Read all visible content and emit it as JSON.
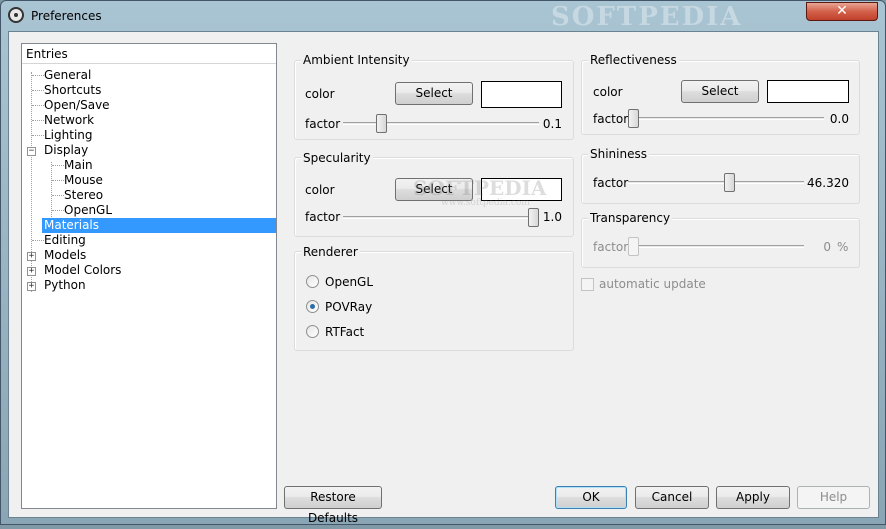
{
  "window": {
    "title": "Preferences",
    "watermark": "SOFTPEDIA",
    "close_glyph": "✕"
  },
  "tree": {
    "header": "Entries",
    "items": [
      {
        "label": "General"
      },
      {
        "label": "Shortcuts"
      },
      {
        "label": "Open/Save"
      },
      {
        "label": "Network"
      },
      {
        "label": "Lighting"
      },
      {
        "label": "Display",
        "expander": "−"
      },
      {
        "label": "Main"
      },
      {
        "label": "Mouse"
      },
      {
        "label": "Stereo"
      },
      {
        "label": "OpenGL"
      },
      {
        "label": "Materials",
        "selected": true
      },
      {
        "label": "Editing"
      },
      {
        "label": "Models",
        "expander": "+"
      },
      {
        "label": "Model Colors",
        "expander": "+"
      },
      {
        "label": "Python",
        "expander": "+"
      }
    ]
  },
  "ambient": {
    "title": "Ambient Intensity",
    "color_label": "color",
    "select_label": "Select",
    "factor_label": "factor",
    "factor_value": "0.1",
    "slider_fraction": 0.1
  },
  "specularity": {
    "title": "Specularity",
    "color_label": "color",
    "select_label": "Select",
    "factor_label": "factor",
    "factor_value": "1.0",
    "slider_fraction": 1.0,
    "watermark": "SOFTPEDIA",
    "watermark_url": "www.softpedia.com"
  },
  "renderer": {
    "title": "Renderer",
    "options": [
      {
        "label": "OpenGL",
        "checked": false
      },
      {
        "label": "POVRay",
        "checked": true
      },
      {
        "label": "RTFact",
        "checked": false
      }
    ]
  },
  "reflectiveness": {
    "title": "Reflectiveness",
    "color_label": "color",
    "select_label": "Select",
    "factor_label": "factor",
    "factor_value": "0.0",
    "slider_fraction": 0.0
  },
  "shininess": {
    "title": "Shininess",
    "factor_label": "factor",
    "factor_value": "46.320",
    "slider_fraction": 0.58
  },
  "transparency": {
    "title": "Transparency",
    "factor_label": "factor",
    "factor_value": "0",
    "unit": "%",
    "slider_fraction": 0.0
  },
  "auto_update": {
    "label": "automatic update",
    "checked": false
  },
  "buttons": {
    "restore": "Restore Defaults",
    "ok": "OK",
    "cancel": "Cancel",
    "apply": "Apply",
    "help": "Help"
  },
  "colors": {
    "selection": "#3399ff",
    "close_button": "#c0402a"
  }
}
